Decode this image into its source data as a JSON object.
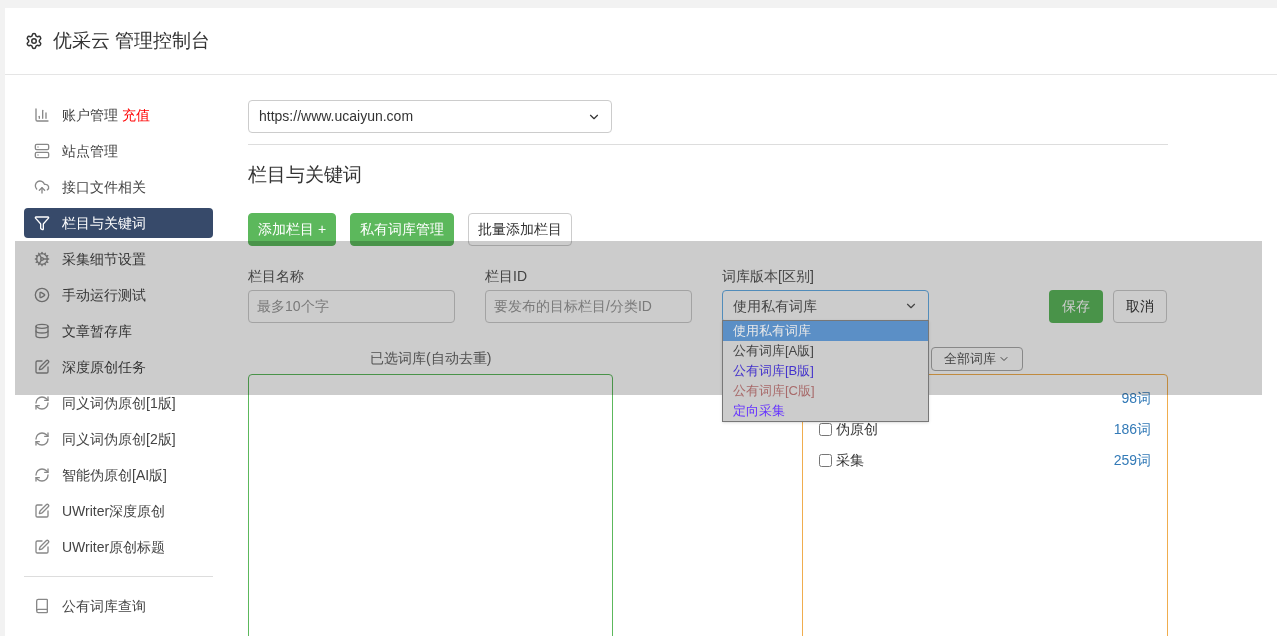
{
  "header": {
    "title": "优采云 管理控制台"
  },
  "sidebar": {
    "items": [
      {
        "label": "账户管理",
        "badge": "充值",
        "selected": false
      },
      {
        "label": "站点管理",
        "selected": false
      },
      {
        "label": "接口文件相关",
        "selected": false
      },
      {
        "label": "栏目与关键词",
        "selected": true
      },
      {
        "label": "采集细节设置",
        "selected": false
      },
      {
        "label": "手动运行测试",
        "selected": false
      },
      {
        "label": "文章暂存库",
        "selected": false
      },
      {
        "label": "深度原创任务",
        "selected": false
      },
      {
        "label": "同义词伪原创[1版]",
        "selected": false
      },
      {
        "label": "同义词伪原创[2版]",
        "selected": false
      },
      {
        "label": "智能伪原创[AI版]",
        "selected": false
      },
      {
        "label": "UWriter深度原创",
        "selected": false
      },
      {
        "label": "UWriter原创标题",
        "selected": false
      }
    ],
    "footer_items": [
      {
        "label": "公有词库查询",
        "selected": false
      }
    ]
  },
  "site_select": {
    "value": "https://www.ucaiyun.com"
  },
  "section_title": "栏目与关键词",
  "buttons": [
    {
      "label": "添加栏目 +",
      "kind": "primary"
    },
    {
      "label": "私有词库管理",
      "kind": "primary"
    },
    {
      "label": "批量添加栏目",
      "kind": "default"
    }
  ],
  "form": {
    "fields": [
      {
        "label": "栏目名称",
        "placeholder": "最多10个字"
      },
      {
        "label": "栏目ID",
        "placeholder": "要发布的目标栏目/分类ID"
      }
    ],
    "version": {
      "label": "词库版本[区别]",
      "value": "使用私有词库",
      "options": [
        {
          "label": "使用私有词库",
          "selected": true
        },
        {
          "label": "公有词库[A版]",
          "selected": false,
          "color": "#444444"
        },
        {
          "label": "公有词库[B版]",
          "selected": false,
          "color": "#4433cc"
        },
        {
          "label": "公有词库[C版]",
          "selected": false,
          "color": "#a86a6a"
        },
        {
          "label": "定向采集",
          "selected": false,
          "color": "#6633ff"
        }
      ]
    },
    "save": "保存",
    "cancel": "取消"
  },
  "library": {
    "label": "已选词库(自动去重)",
    "filter": "全部词库",
    "rows": [
      {
        "count": "98词"
      },
      {
        "label": "伪原创",
        "count": "186词",
        "checked": false
      },
      {
        "label": "采集",
        "count": "259词",
        "checked": false
      }
    ]
  }
}
